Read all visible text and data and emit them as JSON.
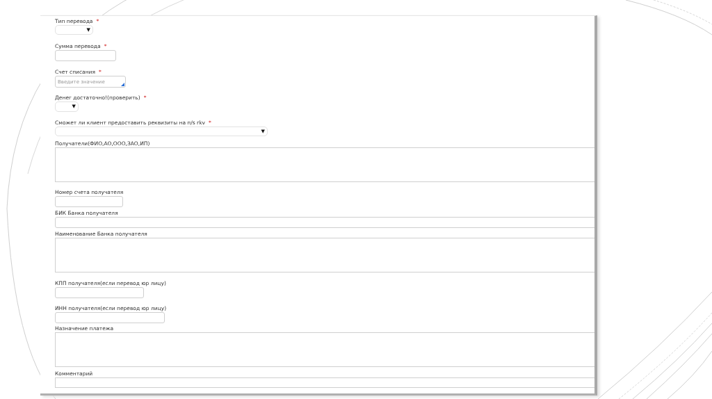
{
  "form": {
    "fields": [
      {
        "label": "Тип перевода",
        "required_mark": "*",
        "kind": "select",
        "arrow": "▼"
      },
      {
        "label": "Сумма перевода",
        "required_mark": "*",
        "kind": "input"
      },
      {
        "label": "Счет списания",
        "required_mark": "*",
        "kind": "lookup",
        "placeholder": "Введите значение"
      },
      {
        "label": "Денег достаточно!(проверить)",
        "required_mark": "*",
        "kind": "select",
        "arrow": "▼"
      },
      {
        "label": "Сможет ли клиент предоставить реквизиты на п/s rkv",
        "required_mark": "*",
        "kind": "select",
        "arrow": "▼"
      },
      {
        "label": "Получатели(ФИО,АО,ООО,ЗАО,ИП)",
        "kind": "textarea"
      },
      {
        "label": "Номер счета получателя",
        "kind": "input"
      },
      {
        "label": "БИК Банка получателя",
        "kind": "input"
      },
      {
        "label": "Наименование Банка получателя",
        "kind": "textarea"
      },
      {
        "label": "КПП получателя(если перевод юр лицу)",
        "kind": "input"
      },
      {
        "label": "ИНН получателя(если перевод юр лицу)",
        "kind": "input"
      },
      {
        "label": "Назначение платежа",
        "kind": "textarea"
      },
      {
        "label": "Комментарий",
        "kind": "textarea"
      }
    ]
  }
}
